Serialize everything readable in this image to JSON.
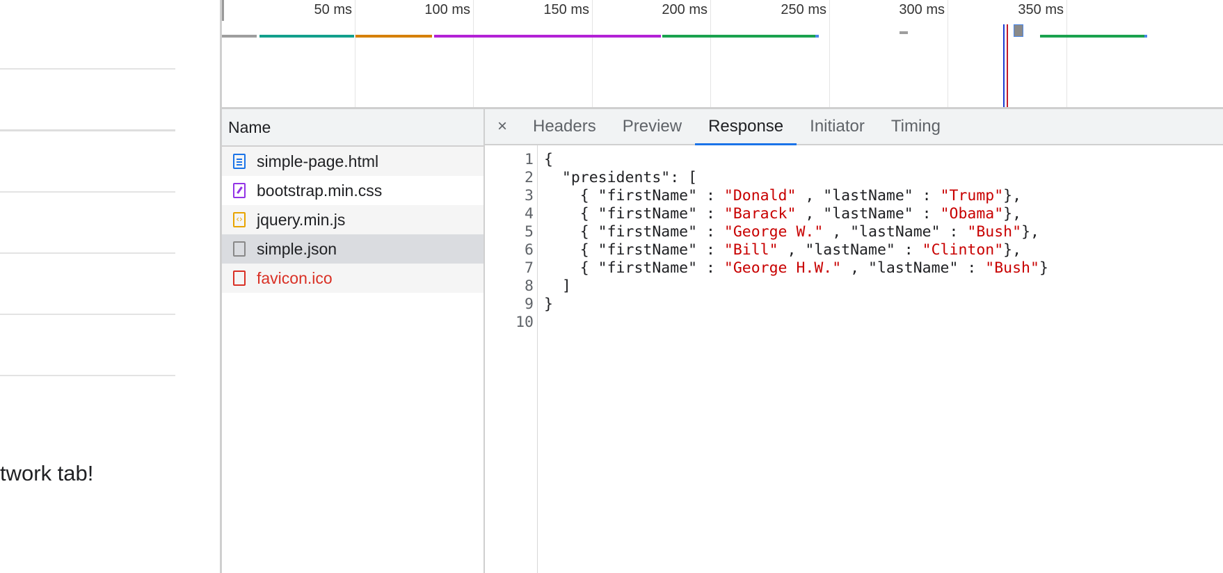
{
  "page": {
    "visible_text": "twork tab!"
  },
  "timeline": {
    "ticks": [
      "50 ms",
      "100 ms",
      "150 ms",
      "200 ms",
      "250 ms",
      "300 ms",
      "350 ms"
    ],
    "colors": {
      "stalled": "#9e9e9e",
      "connection": "#13a08c",
      "waiting": "#d68000",
      "download_purple": "#b322d6",
      "green": "#1aa24f",
      "dom_line": "#1a3ad1",
      "load_line": "#c21a2c",
      "highlight": "#4a86e8"
    }
  },
  "requests": {
    "header": "Name",
    "items": [
      {
        "name": "simple-page.html",
        "icon": "document-icon"
      },
      {
        "name": "bootstrap.min.css",
        "icon": "stylesheet-icon"
      },
      {
        "name": "jquery.min.js",
        "icon": "script-icon"
      },
      {
        "name": "simple.json",
        "icon": "file-icon",
        "selected": true
      },
      {
        "name": "favicon.ico",
        "icon": "file-icon",
        "error": true
      }
    ]
  },
  "detail": {
    "close_symbol": "×",
    "tabs": [
      "Headers",
      "Preview",
      "Response",
      "Initiator",
      "Timing"
    ],
    "active_tab": "Response"
  },
  "response": {
    "line_numbers": [
      "1",
      "2",
      "3",
      "4",
      "5",
      "6",
      "7",
      "8",
      "9",
      "10"
    ],
    "lines": [
      [
        {
          "t": "{"
        }
      ],
      [
        {
          "t": "  \"presidents\": ["
        }
      ],
      [
        {
          "t": "    { \"firstName\" : "
        },
        {
          "t": "\"Donald\"",
          "s": 1
        },
        {
          "t": " , \"lastName\" : "
        },
        {
          "t": "\"Trump\"",
          "s": 1
        },
        {
          "t": "},"
        }
      ],
      [
        {
          "t": "    { \"firstName\" : "
        },
        {
          "t": "\"Barack\"",
          "s": 1
        },
        {
          "t": " , \"lastName\" : "
        },
        {
          "t": "\"Obama\"",
          "s": 1
        },
        {
          "t": "},"
        }
      ],
      [
        {
          "t": "    { \"firstName\" : "
        },
        {
          "t": "\"George W.\"",
          "s": 1
        },
        {
          "t": " , \"lastName\" : "
        },
        {
          "t": "\"Bush\"",
          "s": 1
        },
        {
          "t": "},"
        }
      ],
      [
        {
          "t": "    { \"firstName\" : "
        },
        {
          "t": "\"Bill\"",
          "s": 1
        },
        {
          "t": " , \"lastName\" : "
        },
        {
          "t": "\"Clinton\"",
          "s": 1
        },
        {
          "t": "},"
        }
      ],
      [
        {
          "t": "    { \"firstName\" : "
        },
        {
          "t": "\"George H.W.\"",
          "s": 1
        },
        {
          "t": " , \"lastName\" : "
        },
        {
          "t": "\"Bush\"",
          "s": 1
        },
        {
          "t": "}"
        }
      ],
      [
        {
          "t": "  ]"
        }
      ],
      [
        {
          "t": "}"
        }
      ],
      [
        {
          "t": ""
        }
      ]
    ]
  }
}
